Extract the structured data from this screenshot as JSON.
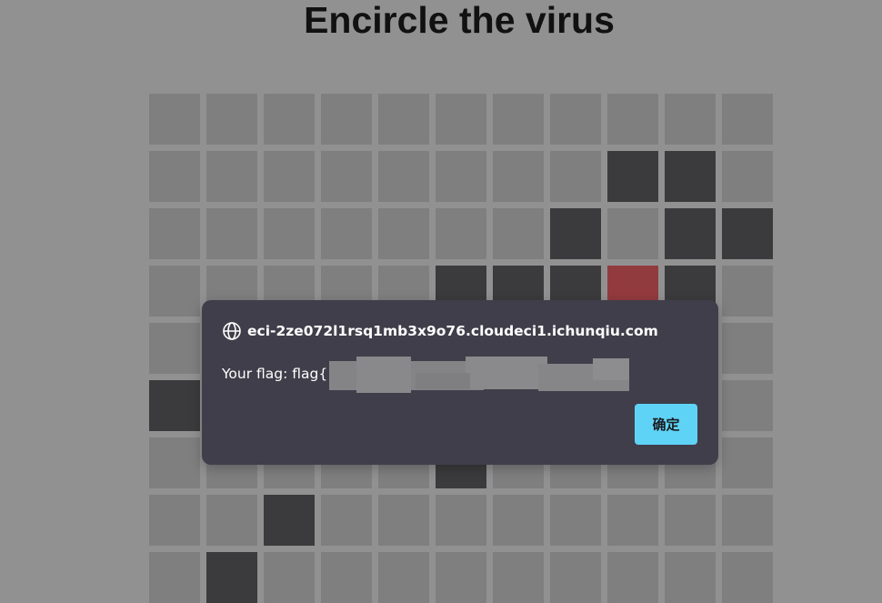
{
  "page": {
    "title": "Encircle the virus"
  },
  "board": {
    "columns": 11,
    "visible_rows": 9,
    "colors": {
      "empty": "#7f7f80",
      "wall": "#3b3b3d",
      "virus": "#923b3e"
    },
    "walls": [
      [
        1,
        8
      ],
      [
        1,
        9
      ],
      [
        2,
        7
      ],
      [
        2,
        9
      ],
      [
        2,
        10
      ],
      [
        3,
        5
      ],
      [
        3,
        6
      ],
      [
        3,
        7
      ],
      [
        3,
        9
      ],
      [
        5,
        0
      ],
      [
        6,
        5
      ],
      [
        7,
        2
      ],
      [
        8,
        1
      ]
    ],
    "virus": [
      3,
      8
    ]
  },
  "dialog": {
    "origin": "eci-2ze072l1rsq1mb3x9o76.cloudeci1.ichunqiu.com",
    "message": "Your flag: flag{",
    "confirm_label": "确定",
    "button_color": "#5fd3f5",
    "background_color": "#403e4a",
    "origin_icon": "globe-icon"
  }
}
